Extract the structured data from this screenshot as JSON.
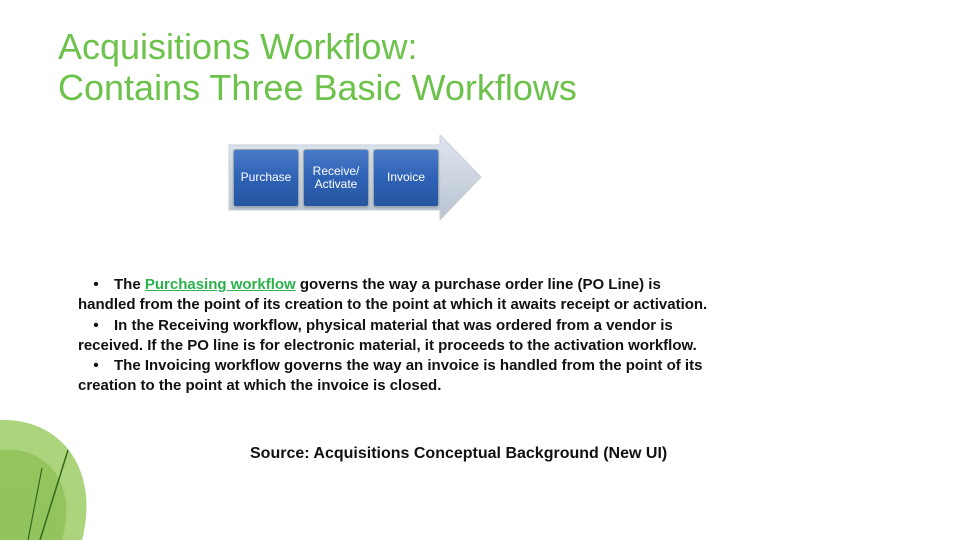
{
  "title_line1": "Acquisitions Workflow:",
  "title_line2": "Contains Three  Basic Workflows",
  "stages": {
    "s0": "Purchase",
    "s1": "Receive/\nActivate",
    "s2": "Invoice"
  },
  "bullets": {
    "b1_pre": "The ",
    "b1_hl": "Purchasing workflow",
    "b1_post": " governs the way a purchase order line (PO Line) is handled from the point of its creation to the point at which it awaits receipt or activation.",
    "b2": "In the Receiving workflow, physical material that was ordered from a vendor is received. If the PO line is for electronic material, it proceeds to the activation workflow.",
    "b3": "The Invoicing workflow governs the way an invoice is handled from the point of its creation to the point at which the invoice is closed."
  },
  "source": "Source: Acquisitions Conceptual Background (New UI)",
  "colors": {
    "accent_green": "#6CC24A",
    "link_green": "#2bb24c",
    "stage_blue": "#2e62b5"
  }
}
